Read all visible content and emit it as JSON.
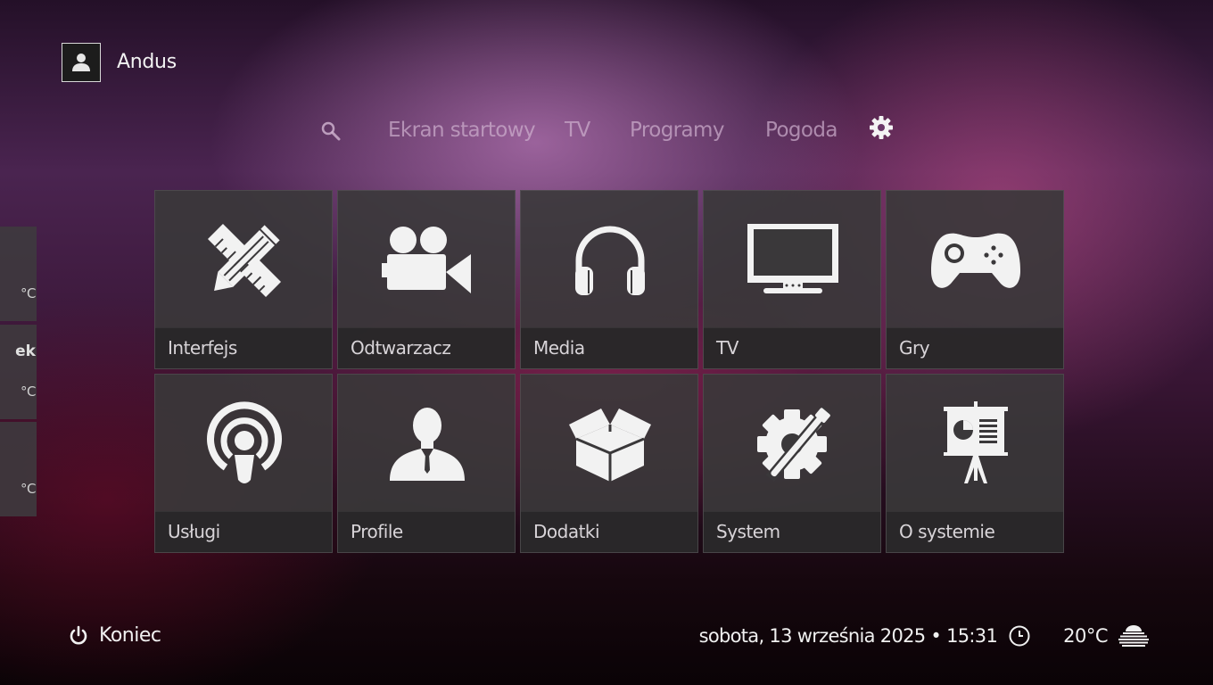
{
  "user": {
    "name": "Andus"
  },
  "nav": {
    "items": [
      {
        "label": "Ekran startowy"
      },
      {
        "label": "TV"
      },
      {
        "label": "Programy"
      },
      {
        "label": "Pogoda"
      }
    ],
    "search_icon": "search-icon",
    "settings_icon": "gear-icon"
  },
  "tiles": [
    {
      "label": "Interfejs",
      "icon": "pencil-ruler-icon"
    },
    {
      "label": "Odtwarzacz",
      "icon": "video-camera-icon"
    },
    {
      "label": "Media",
      "icon": "headphones-icon"
    },
    {
      "label": "TV",
      "icon": "tv-icon"
    },
    {
      "label": "Gry",
      "icon": "gamepad-icon"
    },
    {
      "label": "Usługi",
      "icon": "podcast-icon"
    },
    {
      "label": "Profile",
      "icon": "person-icon"
    },
    {
      "label": "Dodatki",
      "icon": "open-box-icon"
    },
    {
      "label": "System",
      "icon": "gear-wrench-icon"
    },
    {
      "label": "O systemie",
      "icon": "presentation-icon"
    }
  ],
  "side_panels": [
    {
      "title": "",
      "value": "°C"
    },
    {
      "title": "ek",
      "value": "°C"
    },
    {
      "title": "",
      "value": "°C"
    }
  ],
  "footer": {
    "exit_label": "Koniec",
    "datetime": "sobota, 13 września 2025 • 15:31",
    "temperature": "20°C",
    "weather_icon": "fog-icon",
    "clock_icon": "clock-icon"
  },
  "colors": {
    "tile_bg": "#3a383a",
    "tile_label_bg": "#282628",
    "nav_text": "#cdafcd",
    "text": "#f0f0f0"
  }
}
